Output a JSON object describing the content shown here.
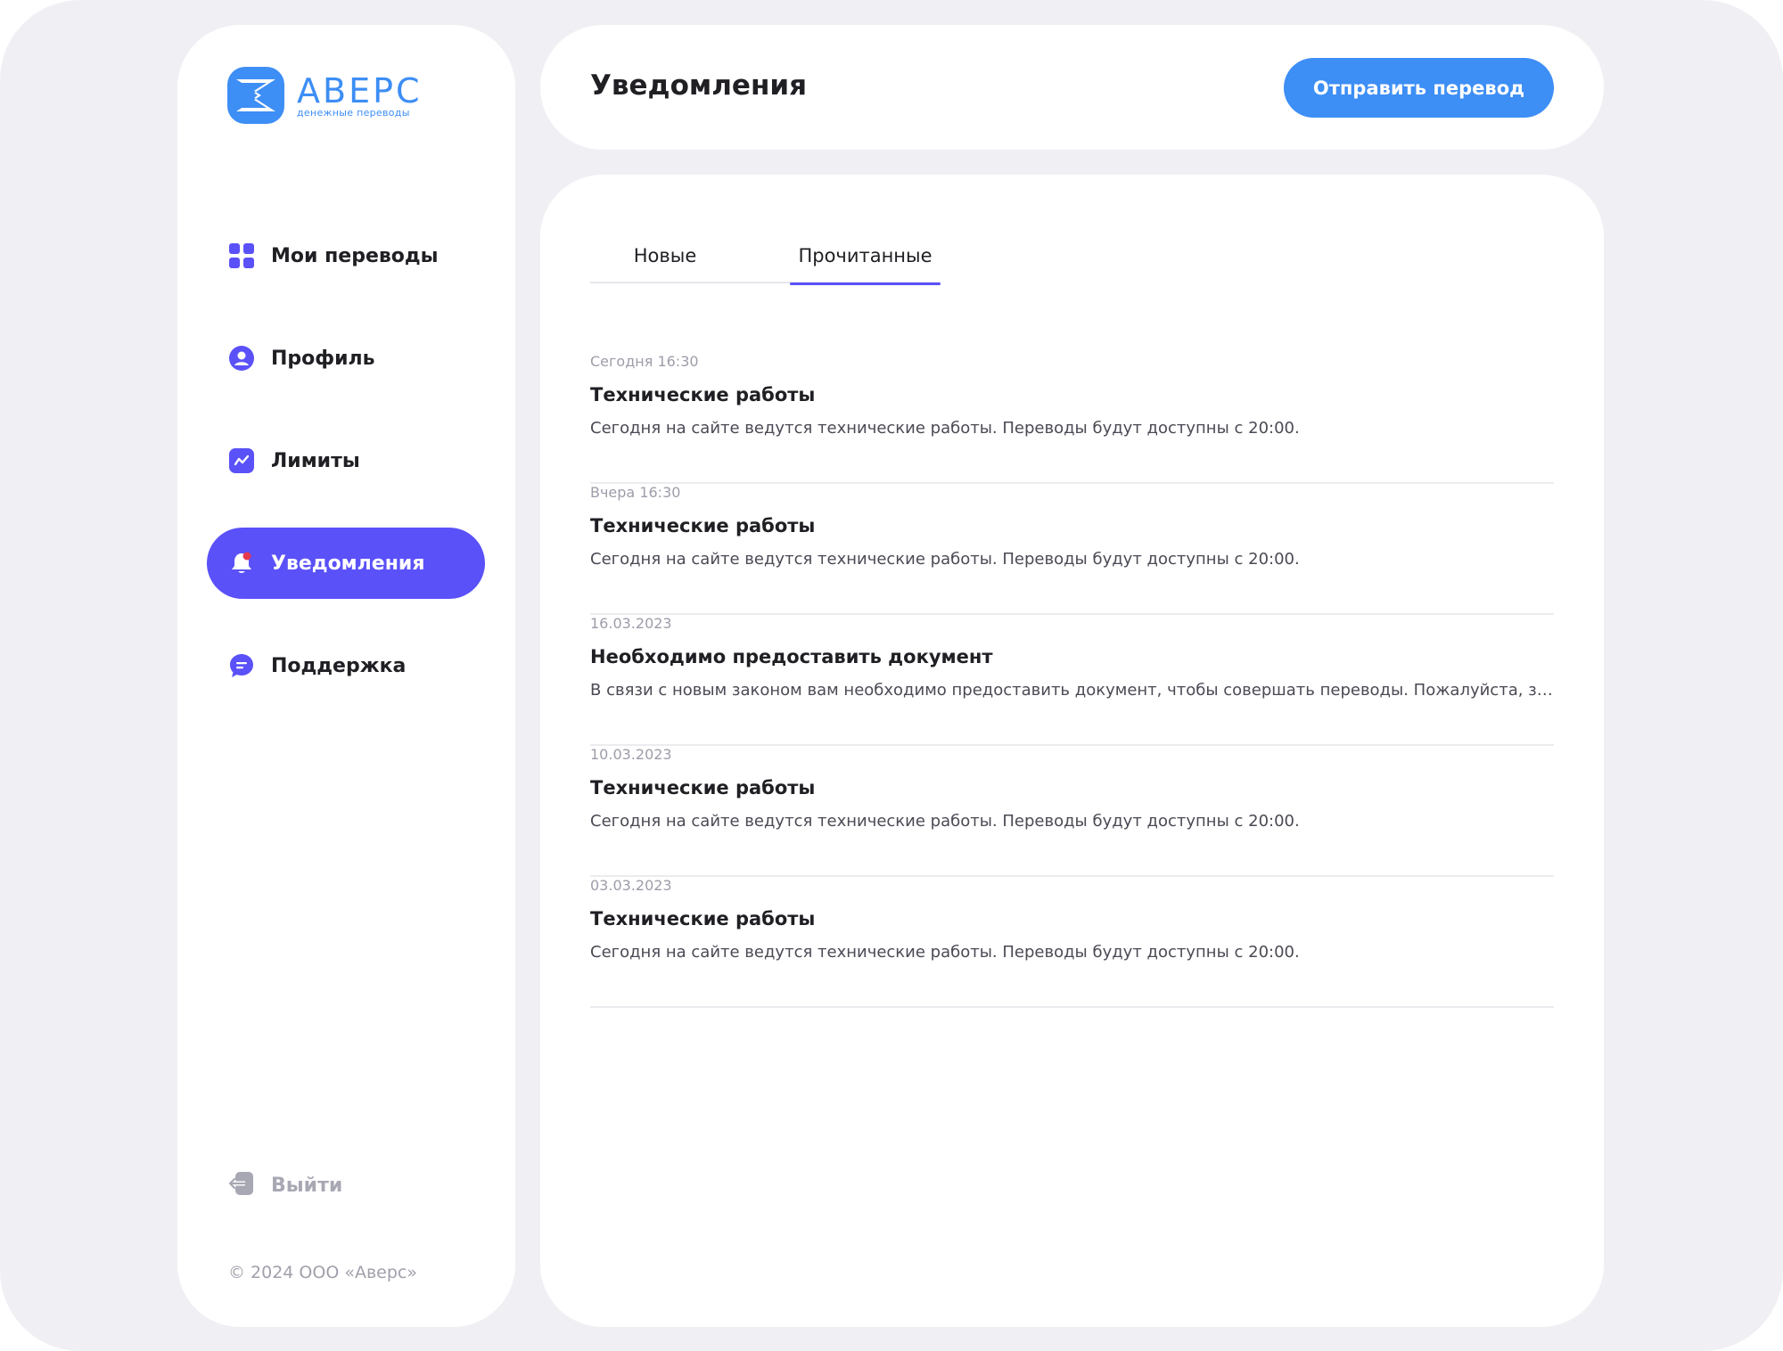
{
  "brand": {
    "name": "АВЕРС",
    "tagline": "денежные переводы",
    "color": "#3d8ef5"
  },
  "sidebar": {
    "items": [
      {
        "label": "Мои переводы",
        "icon": "grid-icon",
        "active": false
      },
      {
        "label": "Профиль",
        "icon": "user-icon",
        "active": false
      },
      {
        "label": "Лимиты",
        "icon": "chart-icon",
        "active": false
      },
      {
        "label": "Уведомления",
        "icon": "bell-icon",
        "active": true
      },
      {
        "label": "Поддержка",
        "icon": "chat-icon",
        "active": false
      }
    ],
    "logout_label": "Выйти",
    "copyright": "© 2024 ООО «Аверс»"
  },
  "header": {
    "title": "Уведомления",
    "send_button_label": "Отправить перевод"
  },
  "tabs": {
    "new_label": "Новые",
    "read_label": "Прочитанные",
    "active": "read"
  },
  "notifications": [
    {
      "date": "Сегодня 16:30",
      "title": "Технические работы",
      "text": "Сегодня на сайте ведутся технические работы. Переводы будут доступны с 20:00."
    },
    {
      "date": "Вчера 16:30",
      "title": "Технические работы",
      "text": "Сегодня на сайте ведутся технические работы. Переводы будут доступны с 20:00."
    },
    {
      "date": "16.03.2023",
      "title": "Необходимо предоставить документ",
      "text": "В связи с новым законом вам необходимо предоставить документ, чтобы совершать переводы. Пожалуйста, загрузите документ в разделе Профиль"
    },
    {
      "date": "10.03.2023",
      "title": "Технические работы",
      "text": "Сегодня на сайте ведутся технические работы. Переводы будут доступны с 20:00."
    },
    {
      "date": "03.03.2023",
      "title": "Технические работы",
      "text": "Сегодня на сайте ведутся технические работы. Переводы будут доступны с 20:00."
    }
  ],
  "colors": {
    "accent": "#5a51f8",
    "primary_button": "#3d8ef5",
    "background": "#f0f0f4"
  }
}
